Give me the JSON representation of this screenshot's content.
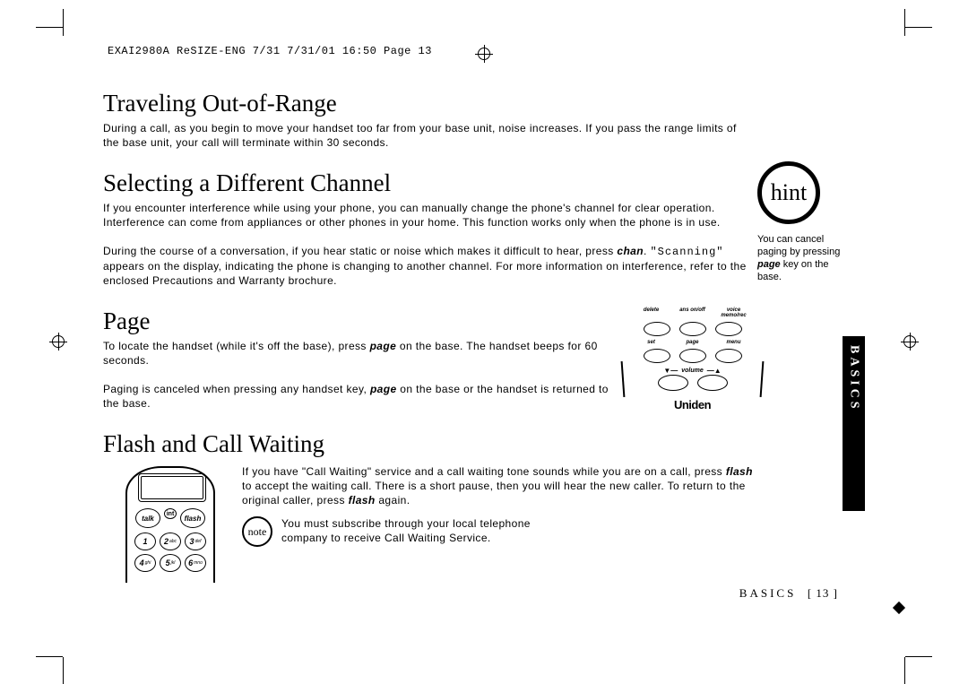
{
  "header_slug": "EXAI2980A ReSIZE-ENG 7/31  7/31/01  16:50  Page 13",
  "sections": {
    "traveling": {
      "title": "Traveling Out-of-Range",
      "para1": "During a call, as you begin to move your handset too far from your base unit, noise increases. If you pass the range limits of the base unit, your call will terminate within 30 seconds."
    },
    "selecting": {
      "title": "Selecting a Different Channel",
      "para1": "If you encounter interference while using your phone, you can manually change the phone's channel for clear operation. Interference can come from appliances or other phones in your home. This function works only when the phone is in use.",
      "para2a": "During the course of a conversation, if you hear static or noise which makes it difficult to hear, press ",
      "para2b": "chan",
      "para2c": ". ",
      "scanning": "\"Scanning\"",
      "para2d": " appears on the display, indicating the phone is changing to another channel. For more information on interference, refer to the enclosed Precautions and Warranty brochure."
    },
    "page": {
      "title": "Page",
      "para1a": "To locate the handset (while it's off the base), press ",
      "para1b": "page",
      "para1c": " on the base. The handset beeps for 60 seconds.",
      "para2a": "Paging is canceled when pressing any handset key, ",
      "para2b": "page",
      "para2c": " on the base or the handset is returned to the base."
    },
    "flash": {
      "title": "Flash and Call Waiting",
      "para1a": "If you have \"Call Waiting\" service and a call waiting tone sounds while you are on a call, press ",
      "para1b": "flash",
      "para1c": " to accept the waiting call. There is a short pause, then you will hear the new caller. To return to the original caller, press ",
      "para1d": "flash",
      "para1e": " again.",
      "note_label": "note",
      "note_text": "You must subscribe through your local telephone company to receive Call Waiting Service."
    }
  },
  "base_labels": {
    "r1": [
      "delete",
      "ans on/off",
      "voice memo/rec"
    ],
    "r2": [
      "set",
      "page",
      "menu"
    ],
    "volume": "volume",
    "brand": "Uniden"
  },
  "handset_keys": {
    "talk": "talk",
    "flash": "flash",
    "int": "int"
  },
  "hint": {
    "label": "hint",
    "text_a": "You can cancel paging by pressing ",
    "text_b": "page",
    "text_c": " key on the base."
  },
  "tab_label": "BASICS",
  "footer": {
    "label": "BASICS",
    "page": "[ 13 ]"
  }
}
